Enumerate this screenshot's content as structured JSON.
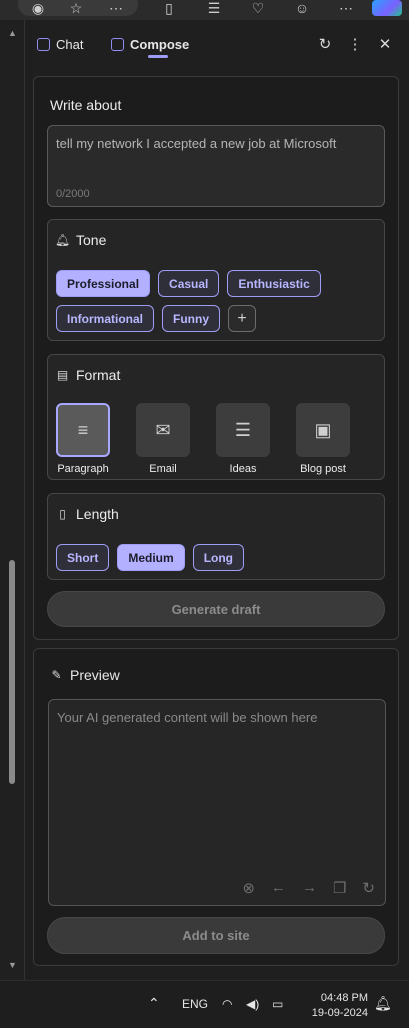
{
  "browser": {
    "icons": [
      "tracking-icon",
      "favorite-star-icon",
      "more-dots-icon",
      "split-screen-icon",
      "favorites-list-icon",
      "browser-essentials-icon",
      "profile-icon",
      "settings-more-icon",
      "copilot-logo"
    ]
  },
  "header": {
    "tabs": [
      {
        "label": "Chat",
        "icon": "chat-icon"
      },
      {
        "label": "Compose",
        "icon": "compose-icon",
        "active": true
      }
    ],
    "icons": [
      "refresh-icon",
      "more-options-icon",
      "close-icon"
    ]
  },
  "write": {
    "label": "Write about",
    "value": "tell my network I accepted a new job at Microsoft",
    "counter": "0/2000"
  },
  "tone": {
    "title": "Tone",
    "icon": "bell-icon",
    "options": [
      "Professional",
      "Casual",
      "Enthusiastic",
      "Informational",
      "Funny"
    ],
    "selected": "Professional",
    "add_icon": "plus-icon"
  },
  "format": {
    "title": "Format",
    "icon": "format-icon",
    "options": [
      "Paragraph",
      "Email",
      "Ideas",
      "Blog post"
    ],
    "selected": "Paragraph"
  },
  "length": {
    "title": "Length",
    "icon": "ruler-icon",
    "options": [
      "Short",
      "Medium",
      "Long"
    ],
    "selected": "Medium"
  },
  "generate_label": "Generate draft",
  "preview": {
    "title": "Preview",
    "icon": "magic-wand-icon",
    "placeholder": "Your AI generated content will be shown here",
    "tools": [
      "stop-icon",
      "previous-icon",
      "next-icon",
      "copy-icon",
      "regenerate-icon"
    ]
  },
  "add_label": "Add to site",
  "taskbar": {
    "language": "ENG",
    "time": "04:48 PM",
    "date": "19-09-2024"
  },
  "colors": {
    "accent": "#9f9cf5",
    "selected_chip": "#b3b1ff",
    "background": "#1f1f1f"
  }
}
